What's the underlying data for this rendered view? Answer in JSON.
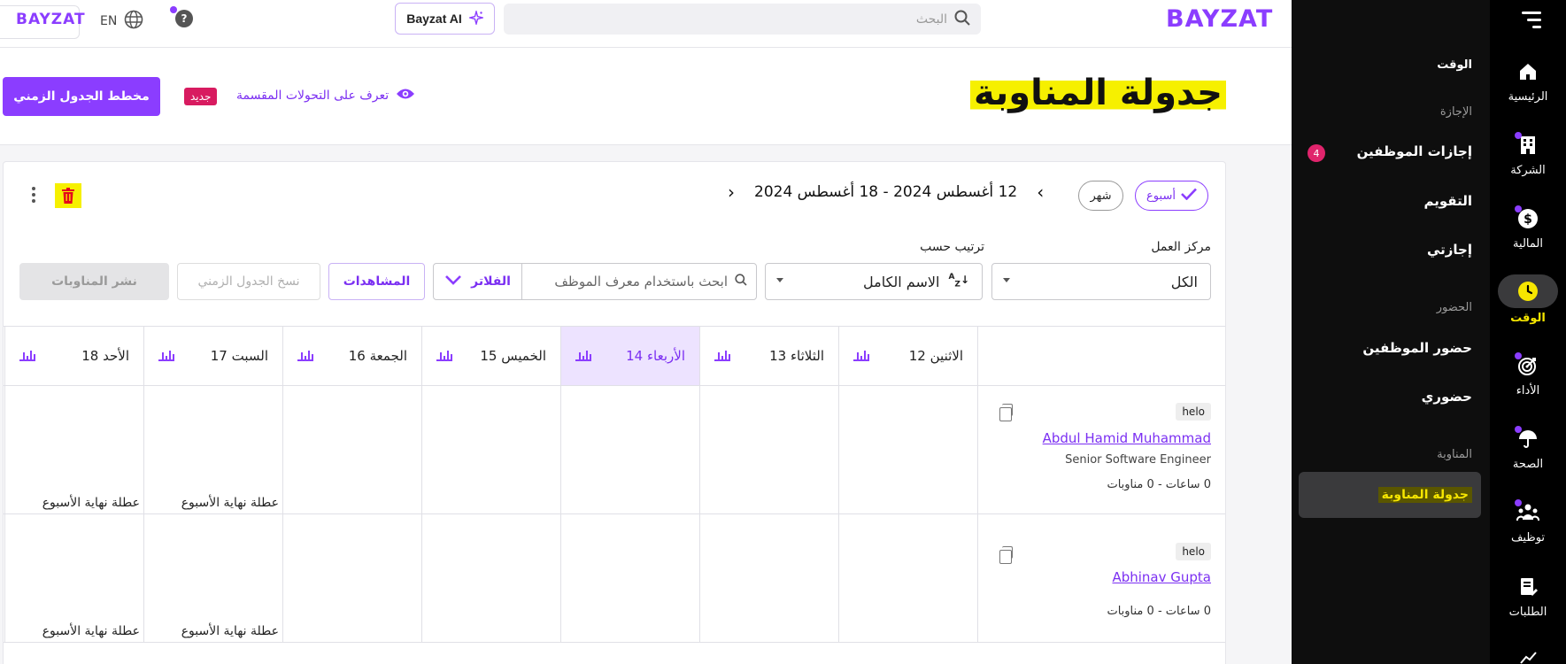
{
  "brand": {
    "logo_small": "BAYZAT",
    "logo_big": "BAYZAT"
  },
  "topbar": {
    "lang": "EN",
    "help": "?",
    "ai_label": "Bayzat AI",
    "search_placeholder": "البحث"
  },
  "rail": {
    "items": [
      {
        "label": "الرئيسية",
        "icon": "home-icon"
      },
      {
        "label": "الشركة",
        "icon": "building-icon"
      },
      {
        "label": "المالية",
        "icon": "dollar-icon"
      },
      {
        "label": "الوقت",
        "icon": "clock-icon"
      },
      {
        "label": "الأداء",
        "icon": "target-icon"
      },
      {
        "label": "الصحة",
        "icon": "umbrella-icon"
      },
      {
        "label": "توظيف",
        "icon": "people-icon"
      },
      {
        "label": "الطلبات",
        "icon": "document-icon"
      }
    ]
  },
  "subnav": {
    "section_time": "الوقت",
    "section_leave": "الإجازة",
    "leave_items": [
      "إجازات الموظفين",
      "التقويم",
      "إجازتي"
    ],
    "leave_badge": "4",
    "section_attendance": "الحضور",
    "attendance_items": [
      "حضور الموظفين",
      "حضوري"
    ],
    "section_shifts": "المناوبة",
    "shift_selected": "جدولة المناوبة"
  },
  "page": {
    "title": "جدولة المناوبة",
    "primary_button": "مخطط الجدول الزمني",
    "new_badge": "جديد",
    "learn_link": "تعرف على التحولات المقسمة"
  },
  "toolbar": {
    "week": "أسبوع",
    "month": "شهر",
    "range": "12 أغسطس 2024 - 18 أغسطس 2024"
  },
  "filters": {
    "work_center_label": "مركز العمل",
    "work_center_value": "الكل",
    "sort_label": "ترتيب حسب",
    "sort_value": "الاسم الكامل",
    "employee_search_placeholder": "ابحث باستخدام معرف الموظف",
    "filters_button": "الفلاتر",
    "views_button": "المشاهدات",
    "copy_schedule_button": "نسخ الجدول الزمني",
    "publish_button": "نشر المناوبات"
  },
  "days": [
    "الاثنين 12",
    "الثلاثاء 13",
    "الأربعاء 14",
    "الخميس 15",
    "الجمعة 16",
    "السبت 17",
    "الأحد 18"
  ],
  "employees": [
    {
      "tag": "helo",
      "name": "Abdul Hamid Muhammad",
      "role": "Senior Software Engineer",
      "hours": "0 ساعات - 0 مناوبات",
      "weekend_label": "عطلة نهاية الأسبوع"
    },
    {
      "tag": "helo",
      "name": "Abhinav Gupta",
      "role": "",
      "hours": "0 ساعات - 0 مناوبات",
      "weekend_label": "عطلة نهاية الأسبوع"
    }
  ],
  "colors": {
    "accent": "#8b3dff",
    "highlight": "#f6f000",
    "badge": "#d81b60"
  }
}
